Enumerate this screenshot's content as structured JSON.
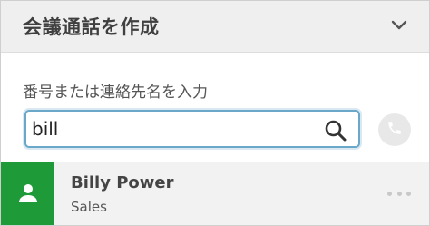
{
  "header": {
    "title": "会議通話を作成",
    "collapse_icon": "chevron-down-icon"
  },
  "search": {
    "label": "番号または連絡先名を入力",
    "value": "bill",
    "search_icon": "search-icon"
  },
  "call": {
    "icon": "phone-icon"
  },
  "results": [
    {
      "name": "Billy Power",
      "department": "Sales",
      "avatar_icon": "person-icon",
      "avatar_color": "#1e9b38",
      "more_icon": "more-options-icon"
    }
  ]
}
